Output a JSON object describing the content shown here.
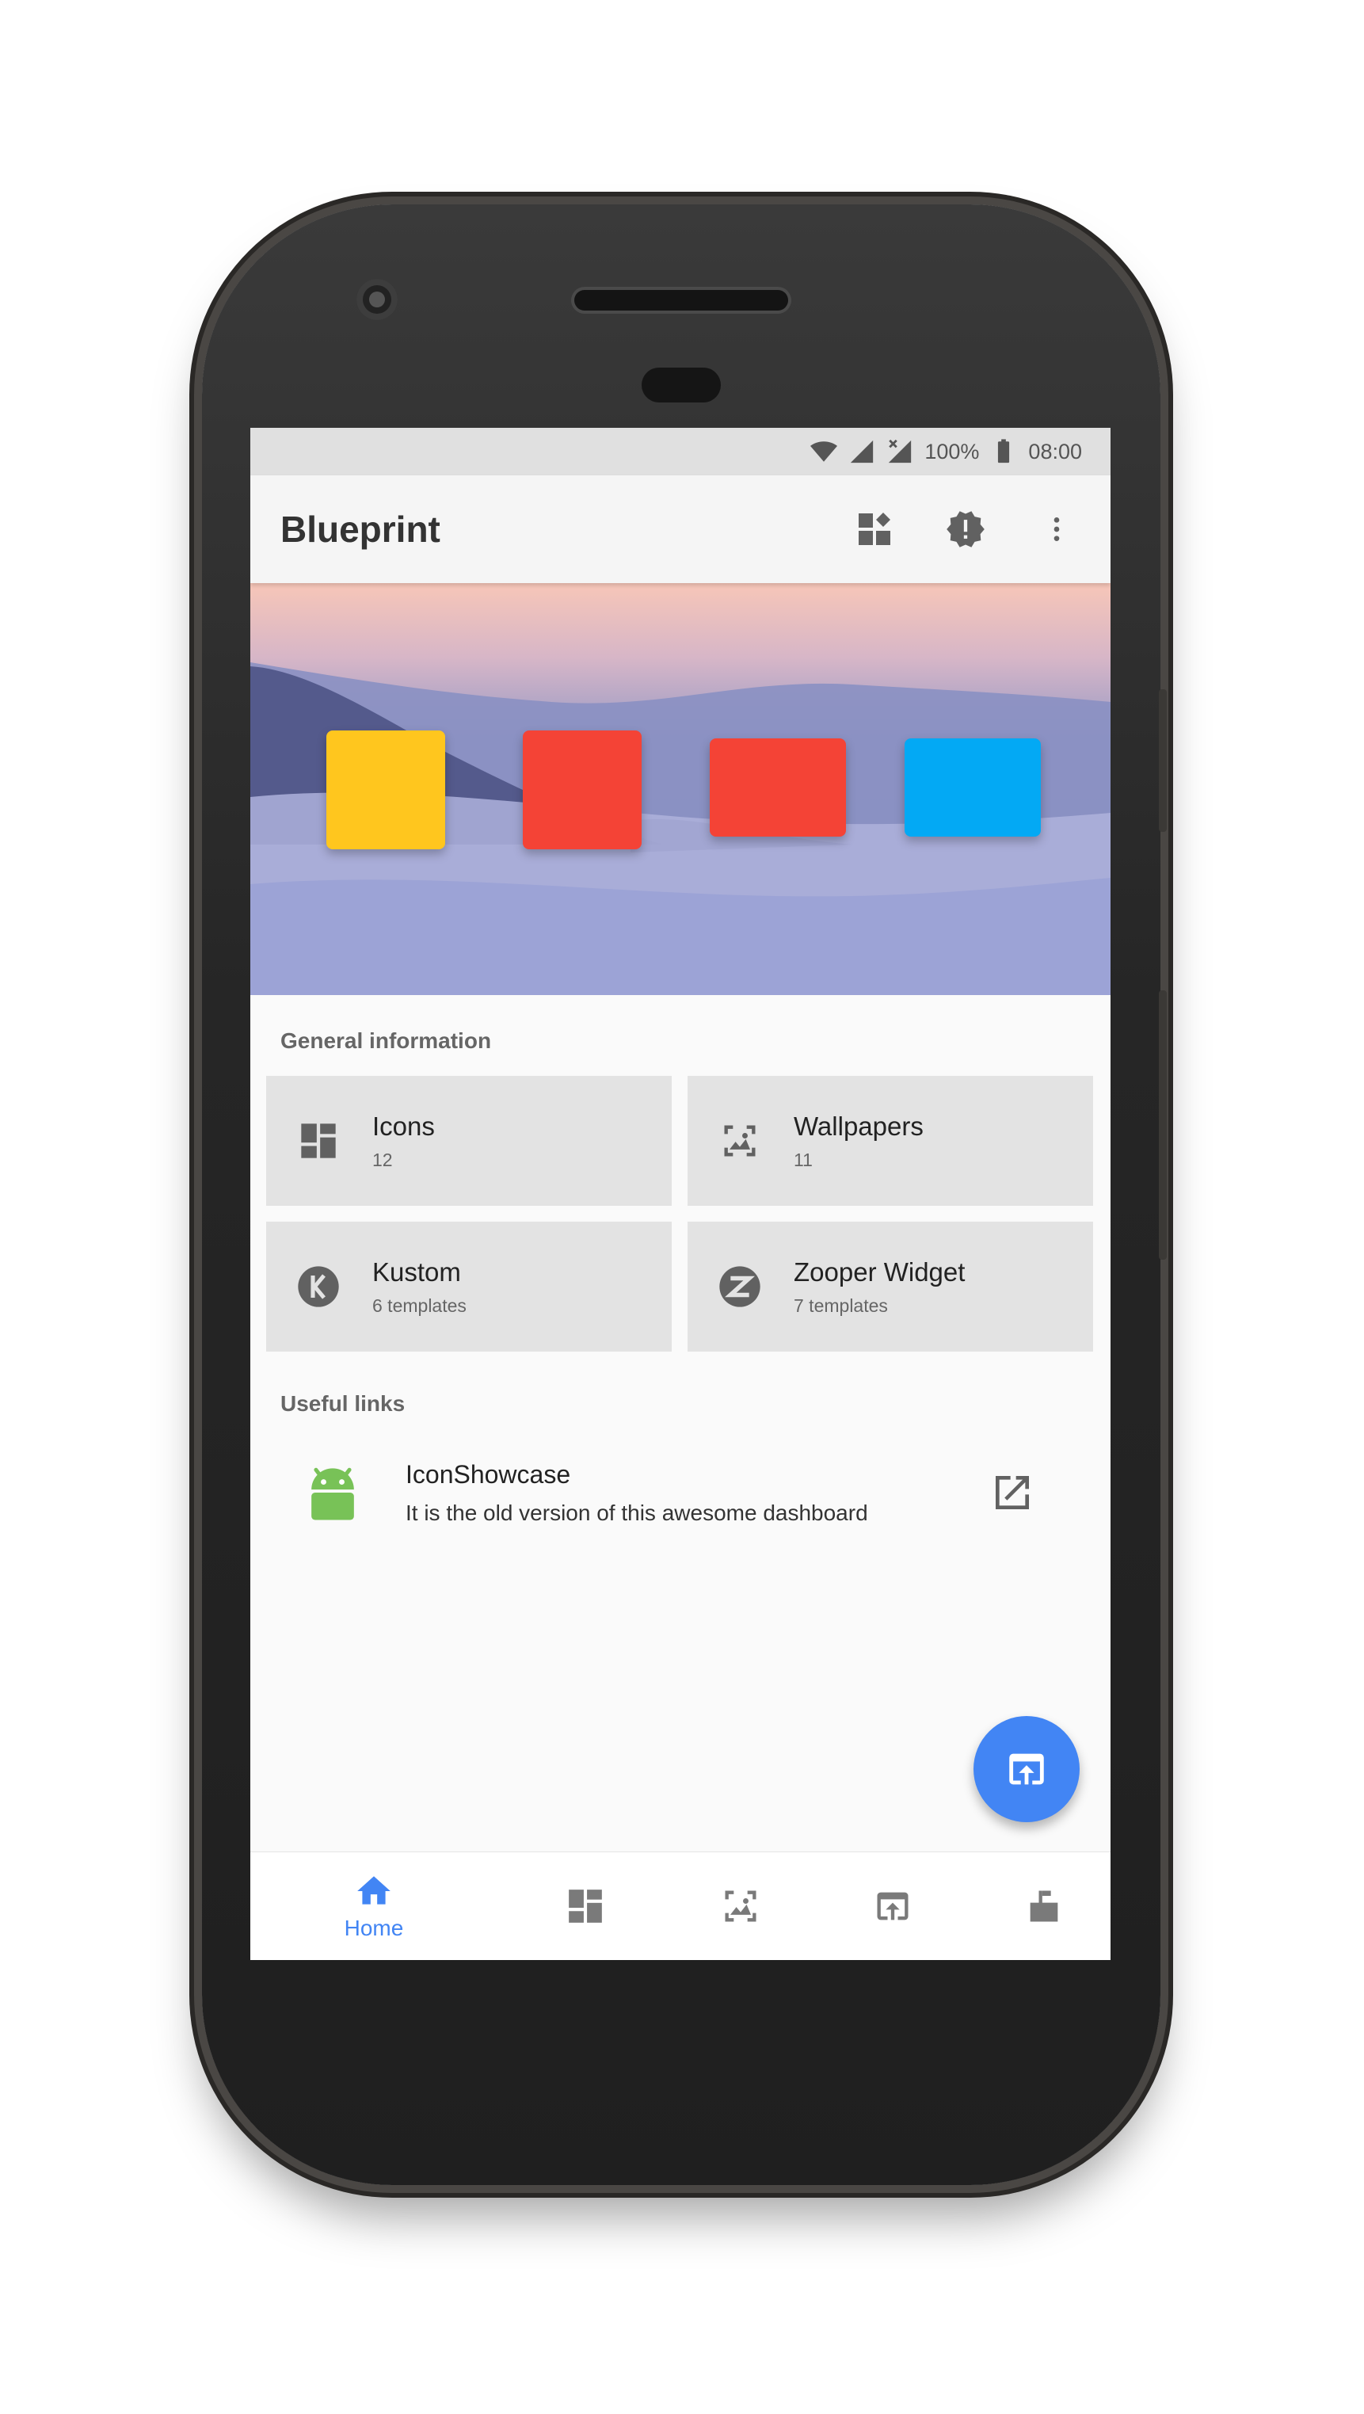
{
  "status_bar": {
    "battery": "100%",
    "time": "08:00"
  },
  "app_bar": {
    "title": "Blueprint",
    "icons": [
      "dashboard-icon",
      "new-releases-icon",
      "more-vert-icon"
    ]
  },
  "hero": {
    "tile_colors": [
      "#FFC61E",
      "#F44336",
      "#F44336",
      "#03A9F4"
    ]
  },
  "general_information": {
    "heading": "General information",
    "cards": [
      {
        "title": "Icons",
        "subtitle": "12",
        "icon": "dashboard-icon"
      },
      {
        "title": "Wallpapers",
        "subtitle": "11",
        "icon": "image-frame-icon"
      },
      {
        "title": "Kustom",
        "subtitle": "6 templates",
        "icon": "kustom-icon"
      },
      {
        "title": "Zooper Widget",
        "subtitle": "7 templates",
        "icon": "zooper-icon"
      }
    ]
  },
  "useful_links": {
    "heading": "Useful links",
    "items": [
      {
        "title": "IconShowcase",
        "description": "It is the old version of this awesome dashboard",
        "icon": "android-icon",
        "action_icon": "open-in-new-icon"
      }
    ]
  },
  "fab": {
    "icon": "open-in-app-icon"
  },
  "bottom_nav": {
    "active": "Home",
    "items": [
      {
        "label": "Home",
        "icon": "home-icon"
      },
      {
        "label": "",
        "icon": "dashboard-icon"
      },
      {
        "label": "",
        "icon": "image-frame-icon"
      },
      {
        "label": "",
        "icon": "open-in-app-icon"
      },
      {
        "label": "",
        "icon": "mailbox-icon"
      }
    ]
  },
  "colors": {
    "accent": "#4285F4",
    "android_green": "#78C257"
  }
}
